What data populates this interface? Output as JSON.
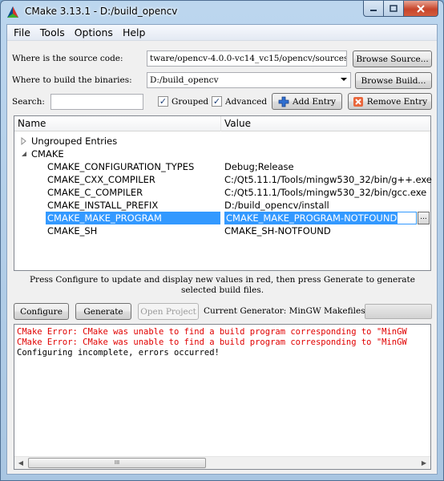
{
  "window": {
    "title": "CMake 3.13.1 - D:/build_opencv"
  },
  "menu": [
    "File",
    "Tools",
    "Options",
    "Help"
  ],
  "source": {
    "label": "Where is the source code:",
    "value": "tware/opencv-4.0.0-vc14_vc15/opencv/sources",
    "button": "Browse Source..."
  },
  "build": {
    "label": "Where to build the binaries:",
    "value": "D:/build_opencv",
    "button": "Browse Build..."
  },
  "search": {
    "label": "Search:",
    "value": "",
    "grouped_label": "Grouped",
    "grouped_checked": true,
    "advanced_label": "Advanced",
    "advanced_checked": true,
    "add_entry": "Add Entry",
    "remove_entry": "Remove Entry"
  },
  "table": {
    "headers": {
      "name": "Name",
      "value": "Value"
    },
    "groups": [
      {
        "label": "Ungrouped Entries",
        "expanded": false
      },
      {
        "label": "CMAKE",
        "expanded": true
      }
    ],
    "rows": [
      {
        "name": "CMAKE_CONFIGURATION_TYPES",
        "value": "Debug;Release"
      },
      {
        "name": "CMAKE_CXX_COMPILER",
        "value": "C:/Qt5.11.1/Tools/mingw530_32/bin/g++.exe"
      },
      {
        "name": "CMAKE_C_COMPILER",
        "value": "C:/Qt5.11.1/Tools/mingw530_32/bin/gcc.exe"
      },
      {
        "name": "CMAKE_INSTALL_PREFIX",
        "value": "D:/build_opencv/install"
      },
      {
        "name": "CMAKE_MAKE_PROGRAM",
        "value": "CMAKE_MAKE_PROGRAM-NOTFOUND",
        "selected": true
      },
      {
        "name": "CMAKE_SH",
        "value": "CMAKE_SH-NOTFOUND"
      }
    ],
    "ellipsis": "..."
  },
  "info": {
    "line1": "Press Configure to update and display new values in red, then press Generate to generate",
    "line2": "selected build files."
  },
  "actions": {
    "configure": "Configure",
    "generate": "Generate",
    "open_project": "Open Project",
    "generator": "Current Generator: MinGW Makefiles"
  },
  "output": [
    {
      "text": "CMake Error: CMake was unable to find a build program corresponding to \"MinGW",
      "error": true
    },
    {
      "text": "CMake Error: CMake was unable to find a build program corresponding to \"MinGW",
      "error": true
    },
    {
      "text": "Configuring incomplete, errors occurred!",
      "error": false
    }
  ],
  "scroll": {
    "thumb_grip": "III"
  },
  "colors": {
    "error": "#e00000",
    "selection": "#3399ff"
  }
}
